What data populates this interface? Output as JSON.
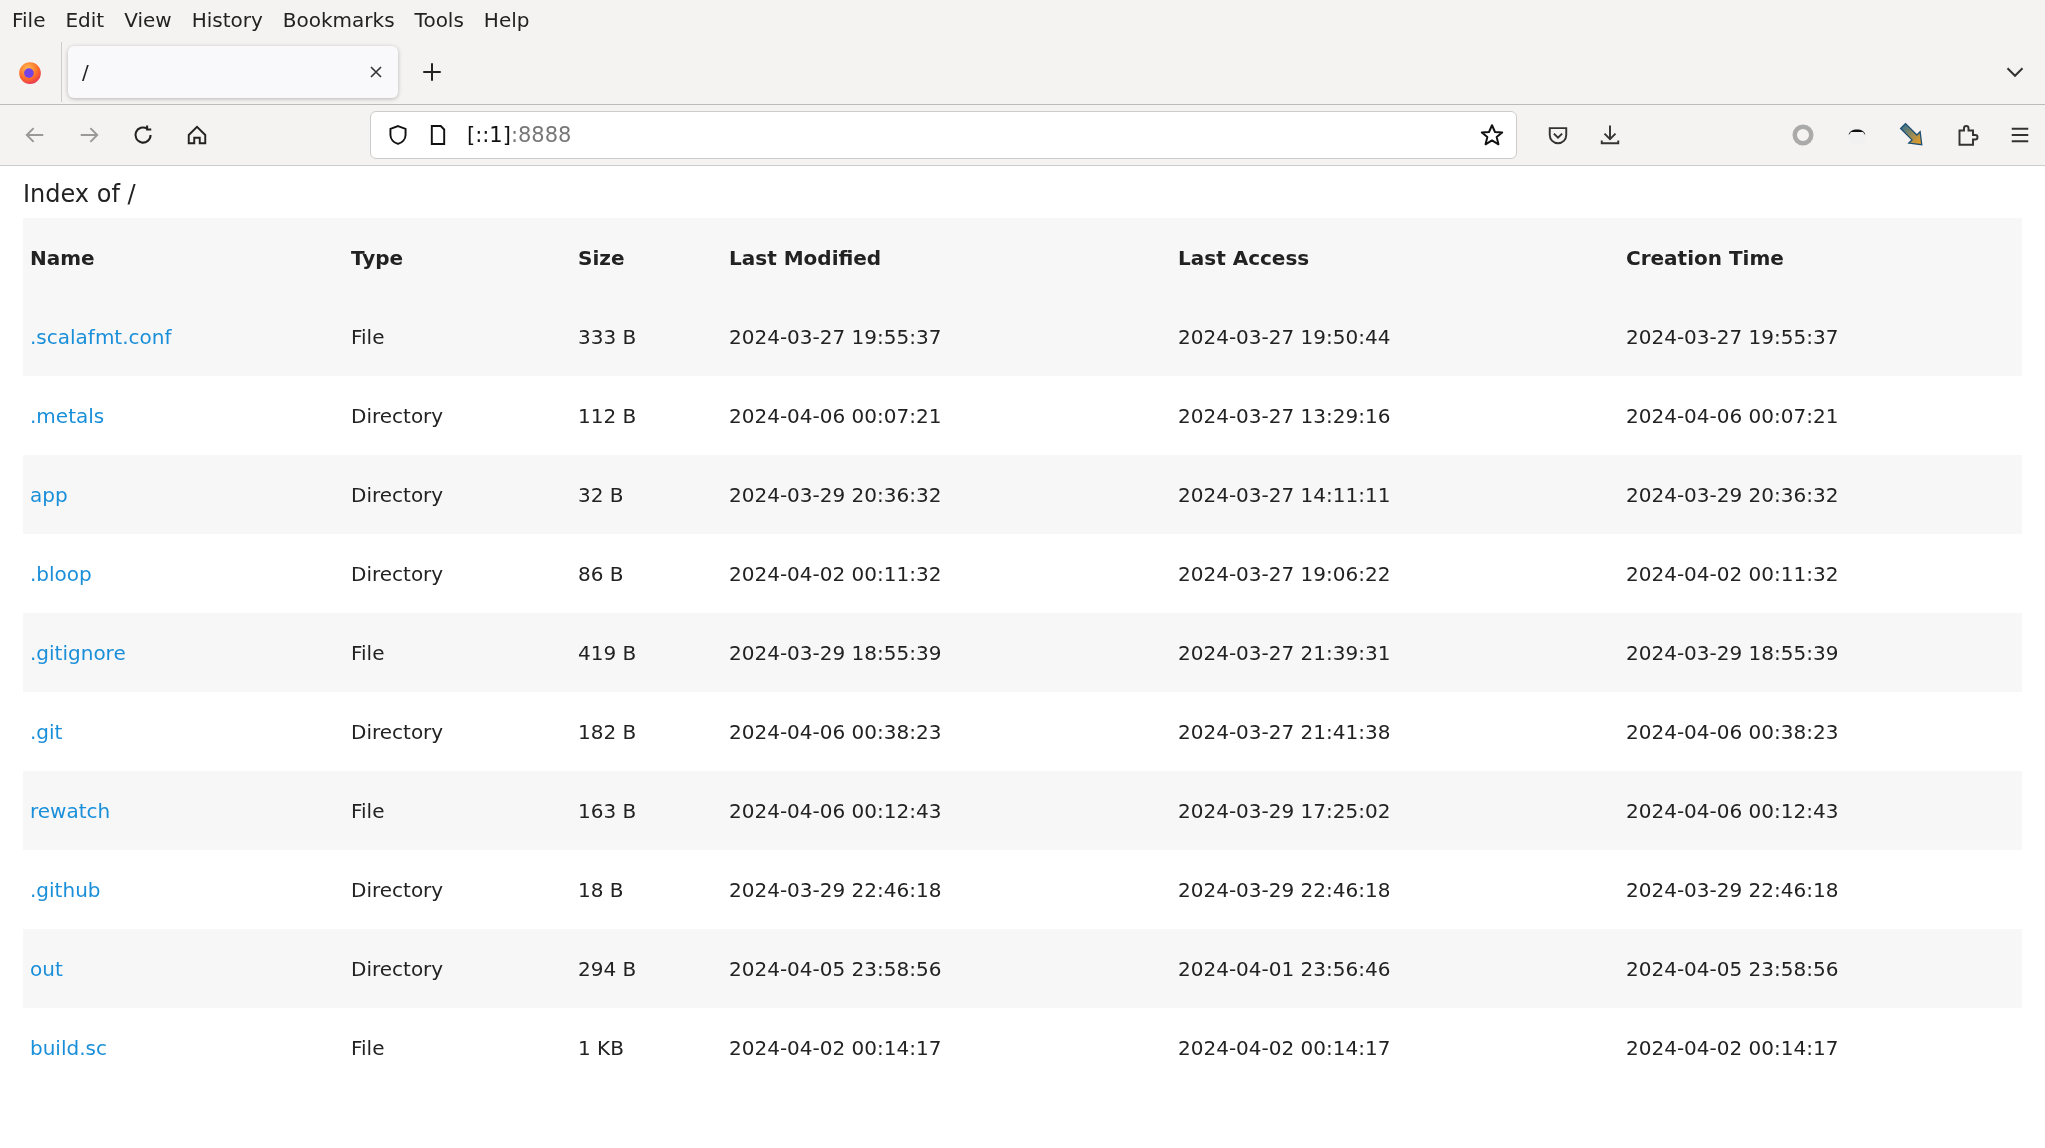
{
  "menu": [
    "File",
    "Edit",
    "View",
    "History",
    "Bookmarks",
    "Tools",
    "Help"
  ],
  "tabs": [
    {
      "title": "/",
      "selected": true
    }
  ],
  "url": {
    "host": "[::1]",
    "port": ":8888"
  },
  "heading": "Index of /",
  "table": {
    "columns": [
      "Name",
      "Type",
      "Size",
      "Last Modified",
      "Last Access",
      "Creation Time"
    ],
    "rows": [
      [
        ".scalafmt.conf",
        "File",
        "333 B",
        "2024-03-27 19:55:37",
        "2024-03-27 19:50:44",
        "2024-03-27 19:55:37"
      ],
      [
        ".metals",
        "Directory",
        "112 B",
        "2024-04-06 00:07:21",
        "2024-03-27 13:29:16",
        "2024-04-06 00:07:21"
      ],
      [
        "app",
        "Directory",
        "32 B",
        "2024-03-29 20:36:32",
        "2024-03-27 14:11:11",
        "2024-03-29 20:36:32"
      ],
      [
        ".bloop",
        "Directory",
        "86 B",
        "2024-04-02 00:11:32",
        "2024-03-27 19:06:22",
        "2024-04-02 00:11:32"
      ],
      [
        ".gitignore",
        "File",
        "419 B",
        "2024-03-29 18:55:39",
        "2024-03-27 21:39:31",
        "2024-03-29 18:55:39"
      ],
      [
        ".git",
        "Directory",
        "182 B",
        "2024-04-06 00:38:23",
        "2024-03-27 21:41:38",
        "2024-04-06 00:38:23"
      ],
      [
        "rewatch",
        "File",
        "163 B",
        "2024-04-06 00:12:43",
        "2024-03-29 17:25:02",
        "2024-04-06 00:12:43"
      ],
      [
        ".github",
        "Directory",
        "18 B",
        "2024-03-29 22:46:18",
        "2024-03-29 22:46:18",
        "2024-03-29 22:46:18"
      ],
      [
        "out",
        "Directory",
        "294 B",
        "2024-04-05 23:58:56",
        "2024-04-01 23:56:46",
        "2024-04-05 23:58:56"
      ],
      [
        "build.sc",
        "File",
        "1 KB",
        "2024-04-02 00:14:17",
        "2024-04-02 00:14:17",
        "2024-04-02 00:14:17"
      ]
    ]
  }
}
